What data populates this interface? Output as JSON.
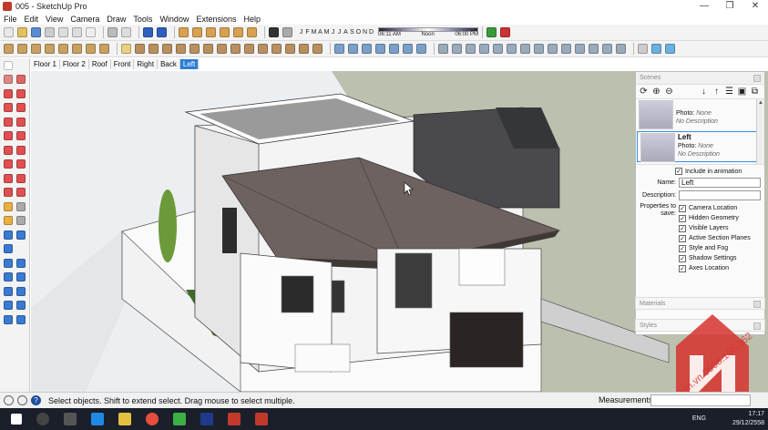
{
  "window": {
    "title": "005 - SketchUp Pro",
    "controls": [
      "—",
      "❐",
      "✕"
    ]
  },
  "menu": [
    "File",
    "Edit",
    "View",
    "Camera",
    "Draw",
    "Tools",
    "Window",
    "Extensions",
    "Help"
  ],
  "shadow_toolbar": {
    "months": [
      "J",
      "F",
      "M",
      "A",
      "M",
      "J",
      "J",
      "A",
      "S",
      "O",
      "N",
      "D"
    ],
    "time_start": "06:11 AM",
    "time_mid": "Noon",
    "time_end": "06:00 PM"
  },
  "scene_tabs": [
    {
      "label": "Floor 1",
      "active": false
    },
    {
      "label": "Floor 2",
      "active": false
    },
    {
      "label": "Roof",
      "active": false
    },
    {
      "label": "Front",
      "active": false
    },
    {
      "label": "Right",
      "active": false
    },
    {
      "label": "Back",
      "active": false
    },
    {
      "label": "Left",
      "active": true
    }
  ],
  "tray": {
    "scenes_title": "Scenes",
    "list": [
      {
        "name": "",
        "photo_label": "Photo:",
        "photo_value": "None",
        "description": "No Description",
        "selected": false
      },
      {
        "name": "Left",
        "photo_label": "Photo:",
        "photo_value": "None",
        "description": "No Description",
        "selected": true
      }
    ],
    "include_in_animation": "Include in animation",
    "name_label": "Name:",
    "name_value": "Left",
    "description_label": "Description:",
    "description_value": "",
    "properties_label": "Properties to save:",
    "properties": [
      "Camera Location",
      "Hidden Geometry",
      "Visible Layers",
      "Active Section Planes",
      "Style and Fog",
      "Shadow Settings",
      "Axes Location"
    ],
    "materials_title": "Materials",
    "styles_title": "Styles"
  },
  "status": {
    "message": "Select objects. Shift to extend select. Drag mouse to select multiple.",
    "measurements_label": "Measurements",
    "measurements_value": ""
  },
  "taskbar": {
    "lang": "ENG",
    "time": "17:17",
    "date": "29/12/2558"
  },
  "watermark": {
    "text": "jthcm.vn 0908.165.362"
  },
  "colors": {
    "accent": "#2d7fd5",
    "taskbar": "#1b1f2a",
    "roof": "#6e6260",
    "tab_active": "#2d7fd5"
  }
}
